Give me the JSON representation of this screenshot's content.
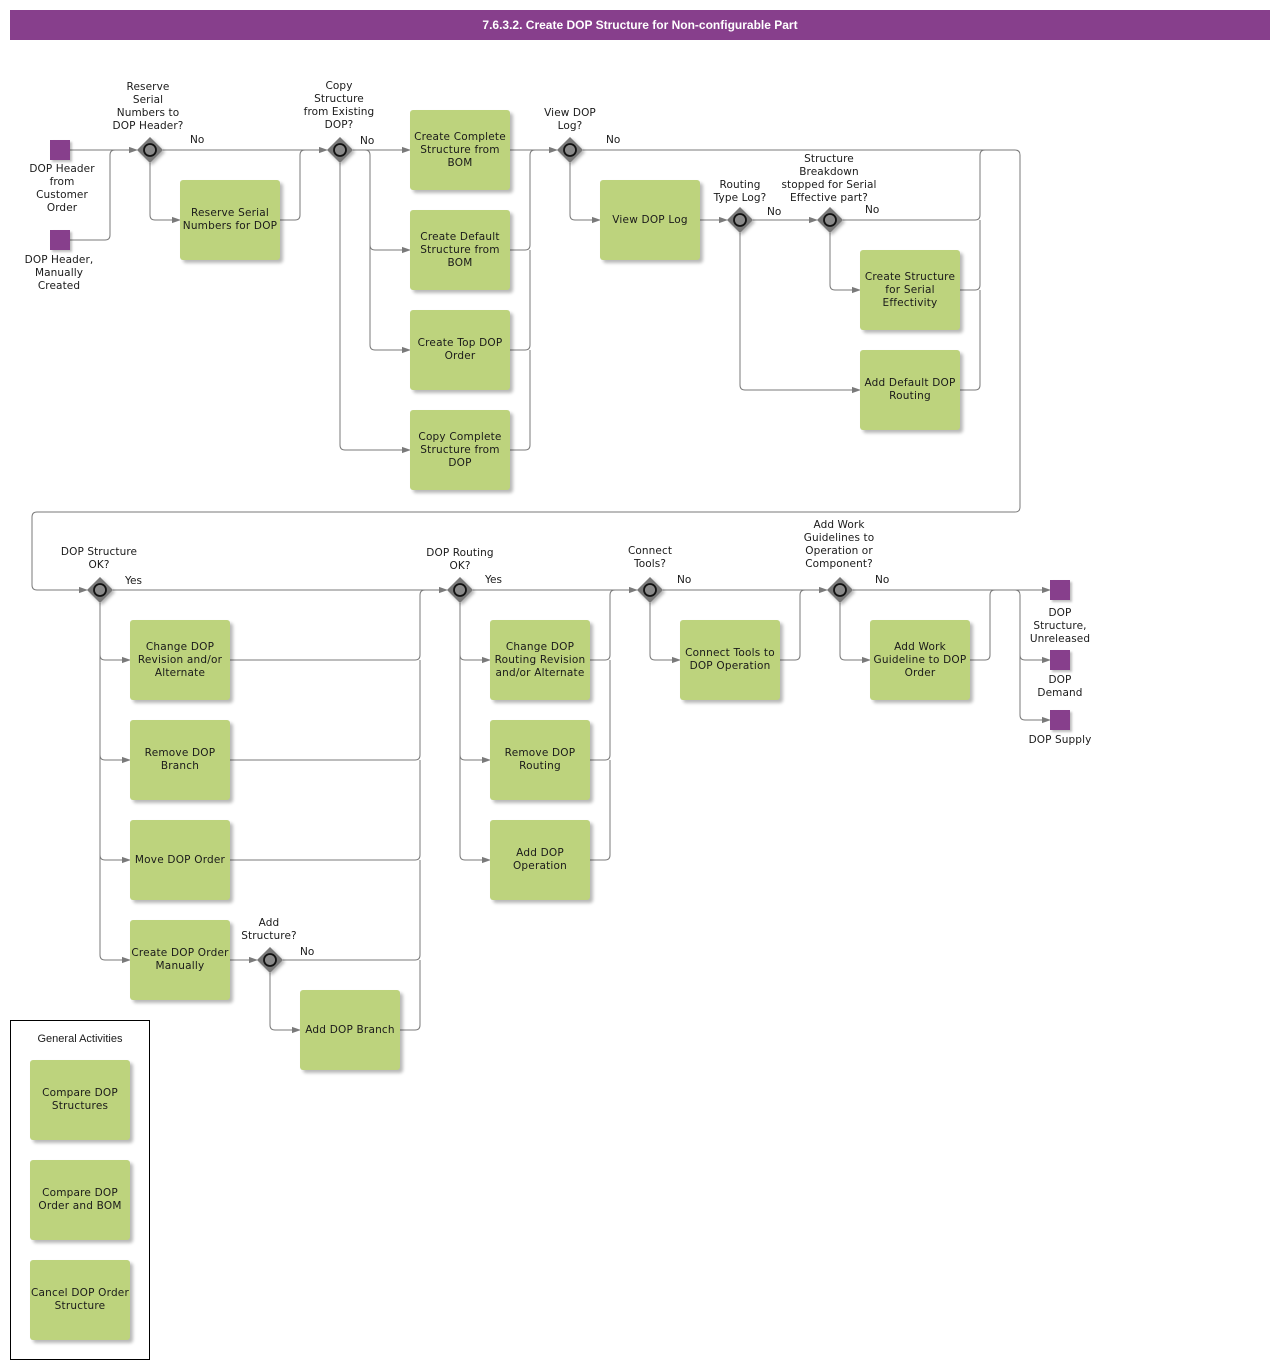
{
  "title": "7.6.3.2. Create DOP Structure for Non-configurable Part",
  "colors": {
    "title_bar": "#873f8c",
    "task_fill": "#bdd37d",
    "event_fill": "#873f8c",
    "gateway_fill": "#777777",
    "connector": "#7a7a7a"
  },
  "events": {
    "start_customer_order": "DOP Header\nfrom\nCustomer\nOrder",
    "start_manual": "DOP Header,\nManually\nCreated",
    "end_structure_unreleased": "DOP\nStructure,\nUnreleased",
    "end_demand": "DOP\nDemand",
    "end_supply": "DOP Supply"
  },
  "gateways": {
    "reserve_serials": "Reserve\nSerial\nNumbers to\nDOP Header?",
    "copy_structure": "Copy\nStructure\nfrom Existing\nDOP?",
    "view_log": "View DOP\nLog?",
    "routing_type_log": "Routing\nType Log?",
    "structure_breakdown": "Structure\nBreakdown\nstopped for Serial\nEffective part?",
    "structure_ok": "DOP Structure\nOK?",
    "add_structure": "Add\nStructure?",
    "routing_ok": "DOP Routing\nOK?",
    "connect_tools": "Connect\nTools?",
    "work_guidelines": "Add Work\nGuidelines to\nOperation or\nComponent?"
  },
  "edge_labels": {
    "reserve_no": "No",
    "copy_no": "No",
    "view_log_no": "No",
    "routing_type_no": "No",
    "breakdown_no": "No",
    "structure_ok_yes": "Yes",
    "add_structure_no": "No",
    "routing_ok_yes": "Yes",
    "connect_tools_no": "No",
    "work_guidelines_no": "No"
  },
  "tasks": {
    "reserve_serial_numbers": "Reserve Serial Numbers for DOP",
    "create_complete_structure_bom": "Create Complete Structure from BOM",
    "create_default_structure_bom": "Create Default Structure from BOM",
    "create_top_dop_order": "Create Top DOP Order",
    "copy_complete_structure_dop": "Copy Complete Structure from DOP",
    "view_dop_log": "View DOP Log",
    "create_structure_serial_effectivity": "Create Structure for Serial Effectivity",
    "add_default_dop_routing": "Add Default DOP Routing",
    "change_dop_revision": "Change DOP Revision and/or Alternate",
    "remove_dop_branch": "Remove DOP Branch",
    "move_dop_order": "Move DOP Order",
    "create_dop_order_manually": "Create DOP Order Manually",
    "add_dop_branch": "Add DOP Branch",
    "change_dop_routing_revision": "Change DOP Routing Revision and/or Alternate",
    "remove_dop_routing": "Remove DOP Routing",
    "add_dop_operation": "Add DOP Operation",
    "connect_tools_to_operation": "Connect Tools to DOP Operation",
    "add_work_guideline": "Add Work Guideline to DOP Order"
  },
  "general_activities": {
    "title": "General Activities",
    "items": [
      "Compare DOP Structures",
      "Compare DOP Order and BOM",
      "Cancel DOP Order Structure"
    ]
  }
}
